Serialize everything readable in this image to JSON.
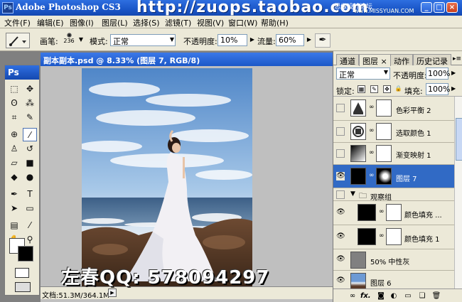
{
  "window": {
    "title": "Adobe Photoshop CS3",
    "logo": "Ps",
    "watermark_url": "http://zuops.taobao.com",
    "watermark_site": "思缘设计论坛",
    "watermark_site2": "www.MISSYUAN.COM",
    "btn_min": "_",
    "btn_max": "□",
    "btn_close": "×"
  },
  "menu": {
    "items": [
      "文件(F)",
      "编辑(E)",
      "图像(I)",
      "图层(L)",
      "选择(S)",
      "滤镜(T)",
      "视图(V)",
      "窗口(W)",
      "帮助(H)"
    ]
  },
  "options": {
    "brush_label": "画笔:",
    "brush_size": "236",
    "mode_label": "模式:",
    "mode_value": "正常",
    "opacity_label": "不透明度:",
    "opacity_value": "10%",
    "flow_label": "流量:",
    "flow_value": "60%"
  },
  "toolbox": {
    "header": "Ps"
  },
  "document": {
    "title": "副本副本.psd @ 8.33% (图层 7, RGB/8)",
    "doc_size": "文档:51.3M/364.1M"
  },
  "qq_watermark": "左春QQ: 578094297",
  "layers_panel": {
    "tabs": [
      "通道",
      "图层",
      "动作",
      "历史记录"
    ],
    "tab_close": "×",
    "blend_mode": "正常",
    "opacity_label": "不透明度:",
    "opacity_value": "100%",
    "lock_label": "锁定:",
    "fill_label": "填充:",
    "fill_value": "100%",
    "layers": [
      {
        "name": "色彩平衡 2",
        "visible": false,
        "selected": false
      },
      {
        "name": "选取颜色 1",
        "visible": false,
        "selected": false
      },
      {
        "name": "渐变映射 1",
        "visible": false,
        "selected": false
      },
      {
        "name": "图层 7",
        "visible": true,
        "selected": true
      },
      {
        "name": "观察组",
        "visible": false,
        "selected": false
      },
      {
        "name": "颜色填充 ...",
        "visible": true,
        "selected": false
      },
      {
        "name": "颜色填充 1",
        "visible": true,
        "selected": false
      },
      {
        "name": "50% 中性灰",
        "visible": true,
        "selected": false
      },
      {
        "name": "图层 6",
        "visible": true,
        "selected": false
      }
    ],
    "footer_icons": [
      "link-icon",
      "fx-icon",
      "mask-icon",
      "adjustment-icon",
      "group-icon",
      "new-layer-icon",
      "trash-icon"
    ]
  }
}
